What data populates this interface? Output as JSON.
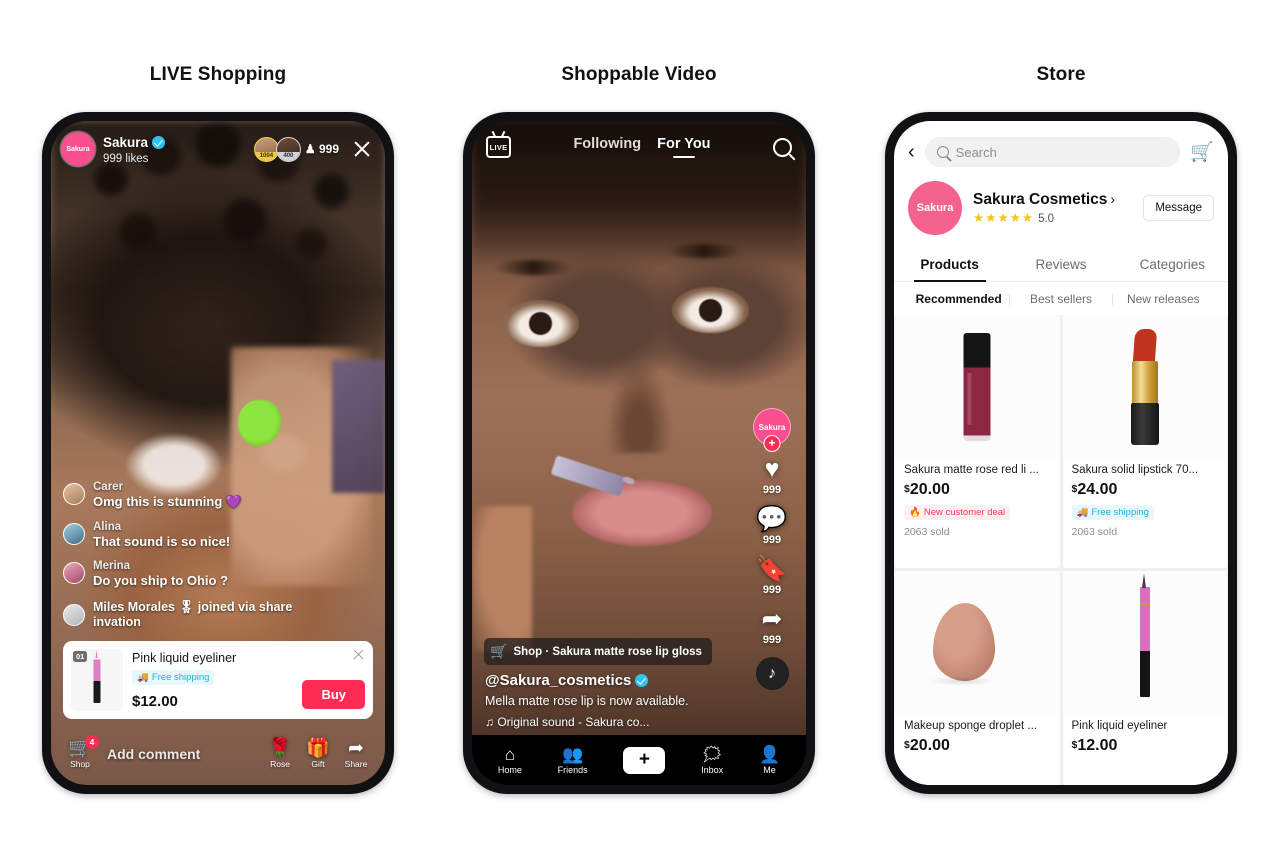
{
  "columns": {
    "live_title": "LIVE Shopping",
    "video_title": "Shoppable Video",
    "store_title": "Store"
  },
  "live": {
    "host": {
      "avatar_label": "Sakura",
      "name": "Sakura",
      "likes": "999 likes",
      "verified_icon": "verified-badge-icon"
    },
    "viewers": {
      "rank1": "1004",
      "rank2": "400",
      "count": "999",
      "person_icon": "person-icon",
      "close_icon": "close-icon"
    },
    "comments": [
      {
        "name": "Carer",
        "text": "Omg this is stunning 💜"
      },
      {
        "name": "Alina",
        "text": "That sound is so nice!"
      },
      {
        "name": "Merina",
        "text": "Do you ship to Ohio ?"
      },
      {
        "name": "",
        "text": "Miles Morales 🎖 joined via share invation"
      }
    ],
    "product": {
      "index": "01",
      "title": "Pink liquid eyeliner",
      "shipping_tag": "Free shipping",
      "shipping_icon": "truck-icon",
      "price": "$12.00",
      "buy_label": "Buy",
      "close_icon": "close-icon"
    },
    "bottom": {
      "shop_label": "Shop",
      "shop_badge": "4",
      "shop_icon": "shopping-cart-icon",
      "add_comment_placeholder": "Add comment",
      "actions": [
        {
          "icon": "rose-icon",
          "glyph": "🌹",
          "label": "Rose"
        },
        {
          "icon": "gift-icon",
          "glyph": "🎁",
          "label": "Gift"
        },
        {
          "icon": "share-icon",
          "glyph": "➦",
          "label": "Share"
        }
      ]
    }
  },
  "video": {
    "live_icon_label": "LIVE",
    "tabs": [
      {
        "label": "Following",
        "active": false
      },
      {
        "label": "For You",
        "active": true
      }
    ],
    "search_icon": "search-icon",
    "rail": {
      "avatar_label": "Sakura",
      "follow_plus": "+",
      "items": [
        {
          "icon": "heart-icon",
          "glyph": "♥",
          "count": "999"
        },
        {
          "icon": "comment-icon",
          "glyph": "💬",
          "count": "999"
        },
        {
          "icon": "bookmark-icon",
          "glyph": "🔖",
          "count": "999"
        },
        {
          "icon": "share-arrow-icon",
          "glyph": "➦",
          "count": "999"
        }
      ],
      "music_disc_glyph": "♪"
    },
    "shop_chip": {
      "bag_icon": "shopping-bag-icon",
      "bag_glyph": "🛒",
      "text": "Shop · Sakura matte rose lip gloss"
    },
    "caption": {
      "handle": "@Sakura_cosmetics",
      "verified_icon": "verified-badge-icon",
      "description": "Mella matte rose lip is now available.",
      "sound": "♫ Original sound - Sakura co..."
    },
    "nav": [
      {
        "label": "Home",
        "icon": "home-icon",
        "glyph": "⌂",
        "active": true
      },
      {
        "label": "Friends",
        "icon": "friends-icon",
        "glyph": "👥",
        "active": false
      },
      {
        "label": "",
        "icon": "create-plus-icon",
        "glyph": "+",
        "active": false
      },
      {
        "label": "Inbox",
        "icon": "inbox-icon",
        "glyph": "🗪",
        "active": false
      },
      {
        "label": "Me",
        "icon": "profile-icon",
        "glyph": "👤",
        "active": false
      }
    ]
  },
  "store": {
    "back_icon": "back-chevron-icon",
    "search": {
      "placeholder": "Search",
      "icon": "search-icon"
    },
    "cart_icon": "shopping-cart-icon",
    "shop": {
      "avatar_label": "Sakura",
      "name": "Sakura Cosmetics",
      "chevron": "›",
      "rating": "5.0",
      "stars": 5,
      "message_label": "Message"
    },
    "tabs": [
      {
        "label": "Products",
        "active": true
      },
      {
        "label": "Reviews",
        "active": false
      },
      {
        "label": "Categories",
        "active": false
      }
    ],
    "filters": [
      {
        "label": "Recommended",
        "active": true
      },
      {
        "label": "Best sellers",
        "active": false
      },
      {
        "label": "New releases",
        "active": false
      }
    ],
    "products": [
      {
        "image": "lip-gloss",
        "name": "Sakura matte rose red li ...",
        "currency": "$",
        "price": "20.00",
        "tag": "New customer deal",
        "tag_type": "deal",
        "tag_glyph": "🔥",
        "sold": "2063 sold"
      },
      {
        "image": "lipstick",
        "name": "Sakura solid lipstick 70...",
        "currency": "$",
        "price": "24.00",
        "tag": "Free shipping",
        "tag_type": "ship",
        "tag_glyph": "🚚",
        "sold": "2063 sold"
      },
      {
        "image": "sponge",
        "name": "Makeup sponge droplet ...",
        "currency": "$",
        "price": "20.00",
        "tag": "",
        "tag_type": "",
        "tag_glyph": "",
        "sold": ""
      },
      {
        "image": "eyeliner",
        "name": "Pink liquid eyeliner",
        "currency": "$",
        "price": "12.00",
        "tag": "",
        "tag_type": "",
        "tag_glyph": "",
        "sold": ""
      }
    ]
  },
  "colors": {
    "brand_red": "#fe2c55",
    "pink": "#f4638e",
    "cyan": "#25f4ee",
    "star": "#f5c518",
    "ship_tag": "#1ab6d6"
  }
}
